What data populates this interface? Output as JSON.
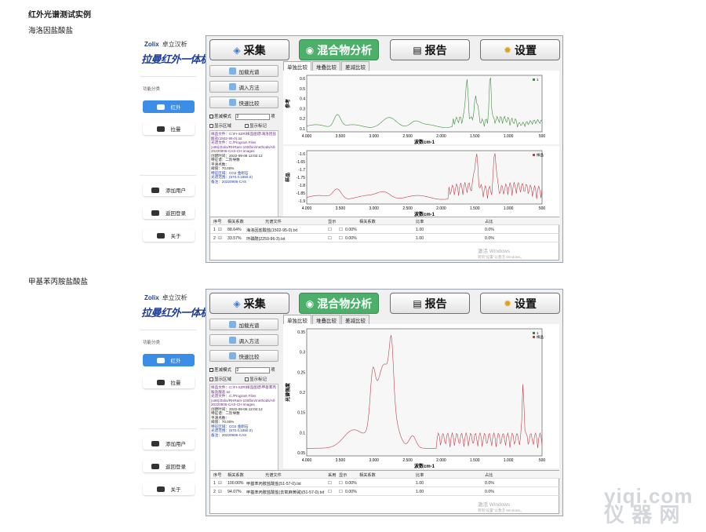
{
  "heading": "红外光谱测试实例",
  "watermark": {
    "line1": "yiqi.com",
    "line2": "仪 器 网"
  },
  "sections": [
    {
      "title": "海洛因盐酸盐",
      "sidebar": {
        "logo": "Zolix",
        "logo_cn": "卓立汉析",
        "brand": "拉曼红外一体机",
        "func_label": "功能分类",
        "items": [
          "红外",
          "拉曼"
        ],
        "bottom": [
          "添加用户",
          "返回登录",
          "关于"
        ]
      },
      "toolbar": {
        "collect": "采集",
        "mix": "混合物分析",
        "report": "报告",
        "settings": "设置"
      },
      "left": {
        "load": "加载光谱",
        "method": "调入方法",
        "quick": "快速比较",
        "stack_label": "差减模式",
        "stack_value": "2",
        "item_suffix": "项",
        "show_peak": "显示区域",
        "show_label": "显示标记",
        "info": [
          "样品文件：C:\\FI-XZR\\样品图谱\\海洛因盐酸盐(1502-95-0).txt",
          "光谱文件：C:/Program Files (x86)/Zolix/RHRaIn-100/bin/methods/All-20220906-CAS-CH images",
          "创建时间：2022-09-06 12:02:12",
          "特征谱：二阶导数",
          "平滑点数：",
          "阈值：70.00%",
          "特征区域：CO2  金刚石",
          "光谱范围：(570.0,1850.0)",
          "备注：20220906-CAS"
        ]
      },
      "tabs": [
        "单独比较",
        "堆叠比较",
        "差减比较"
      ],
      "table": {
        "headers": [
          "序号",
          "相关系数",
          "光谱文件",
          "显示",
          "相关系数",
          "比率",
          "占比"
        ],
        "rows": [
          [
            "1",
            "88.64%",
            "海洛因盐酸盐(1502-95-0).txt",
            "0.00%",
            "1.00",
            "0.0%"
          ],
          [
            "2",
            "33.57%",
            "环磷酰(2259-96-3).txt",
            "0.00%",
            "1.00",
            "0.0%"
          ]
        ]
      },
      "activation": {
        "line1": "激活 Windows",
        "line2": "转到\"设置\"以激活 Windows。"
      },
      "charts": [
        {
          "legend": "1",
          "color": "#3b8f3b",
          "ylabel": "参考",
          "xlabel": "波数cm-1",
          "xticks": [
            "4.000",
            "3.500",
            "3.000",
            "2.500",
            "2.000",
            "1.500",
            "1.000",
            "500"
          ],
          "yticks": [
            "0.6",
            "0.5",
            "0.4",
            "0.3",
            "0.2",
            "0.1"
          ]
        },
        {
          "legend": "样品",
          "color": "#c0404a",
          "ylabel": "样品",
          "xlabel": "波数cm-1",
          "xticks": [
            "4.000",
            "3.500",
            "3.000",
            "2.500",
            "2.000",
            "1.500",
            "1.000",
            "500"
          ],
          "yticks": [
            "-1.6",
            "-1.65",
            "-1.7",
            "-1.75",
            "-1.8",
            "-1.85",
            "-1.9"
          ]
        }
      ]
    },
    {
      "title": "甲基苯丙胺盐酸盐",
      "sidebar": {
        "logo": "Zolix",
        "logo_cn": "卓立汉析",
        "brand": "拉曼红外一体机",
        "func_label": "功能分类",
        "items": [
          "红外",
          "拉曼"
        ],
        "bottom": [
          "添加用户",
          "返回登录",
          "关于"
        ]
      },
      "toolbar": {
        "collect": "采集",
        "mix": "混合物分析",
        "report": "报告",
        "settings": "设置"
      },
      "left": {
        "load": "加载光谱",
        "method": "调入方法",
        "quick": "快速比较",
        "stack_label": "差减模式",
        "stack_value": "2",
        "item_suffix": "项",
        "show_peak": "显示区域",
        "show_label": "显示标记",
        "info": [
          "样品文件：C:\\FI-XZR\\样品图谱\\甲基苯丙胺盐酸盐.txt",
          "光谱文件：C:/Program Files (x86)/Zolix/RHRaIn-100/bin/methods/All-20220906-CAS-CH images",
          "创建时间：2022-09-06 12:02:12",
          "特征谱：二阶导数",
          "平滑点数：",
          "阈值：70.00%",
          "特征区域：CO2  金刚石",
          "光谱范围：(570.0,1850.0)",
          "备注：20220906-CAS"
        ]
      },
      "tabs": [
        "单独比较",
        "堆叠比较",
        "差减比较"
      ],
      "table": {
        "headers": [
          "序号",
          "相关系数",
          "光谱文件",
          "采用",
          "显示",
          "相关系数",
          "比率",
          "占比"
        ],
        "rows": [
          [
            "1",
            "100.00%",
            "甲基苯丙胺盐酸盐(51-57-0).txt",
            "0.00%",
            "1.00",
            "0.0%"
          ],
          [
            "2",
            "94.07%",
            "甲基苯丙胺盐酸盐(去氧麻黄碱)(51-57-0).txt",
            "0.00%",
            "1.00",
            "0.0%"
          ]
        ]
      },
      "activation": {
        "line1": "激活 Windows",
        "line2": "转到\"设置\"以激活 Windows。"
      },
      "charts": [
        {
          "legend": "1",
          "legend2": "样品",
          "color": "#c0404a",
          "ylabel": "光谱强度",
          "xlabel": "波数cm-1",
          "xticks": [
            "4.000",
            "3.500",
            "3.000",
            "2.500",
            "2.000",
            "1.500",
            "1.000",
            "500"
          ],
          "yticks": [
            "0.35",
            "0.3",
            "0.25",
            "0.2",
            "0.15",
            "0.1",
            "0.05"
          ]
        }
      ]
    }
  ]
}
